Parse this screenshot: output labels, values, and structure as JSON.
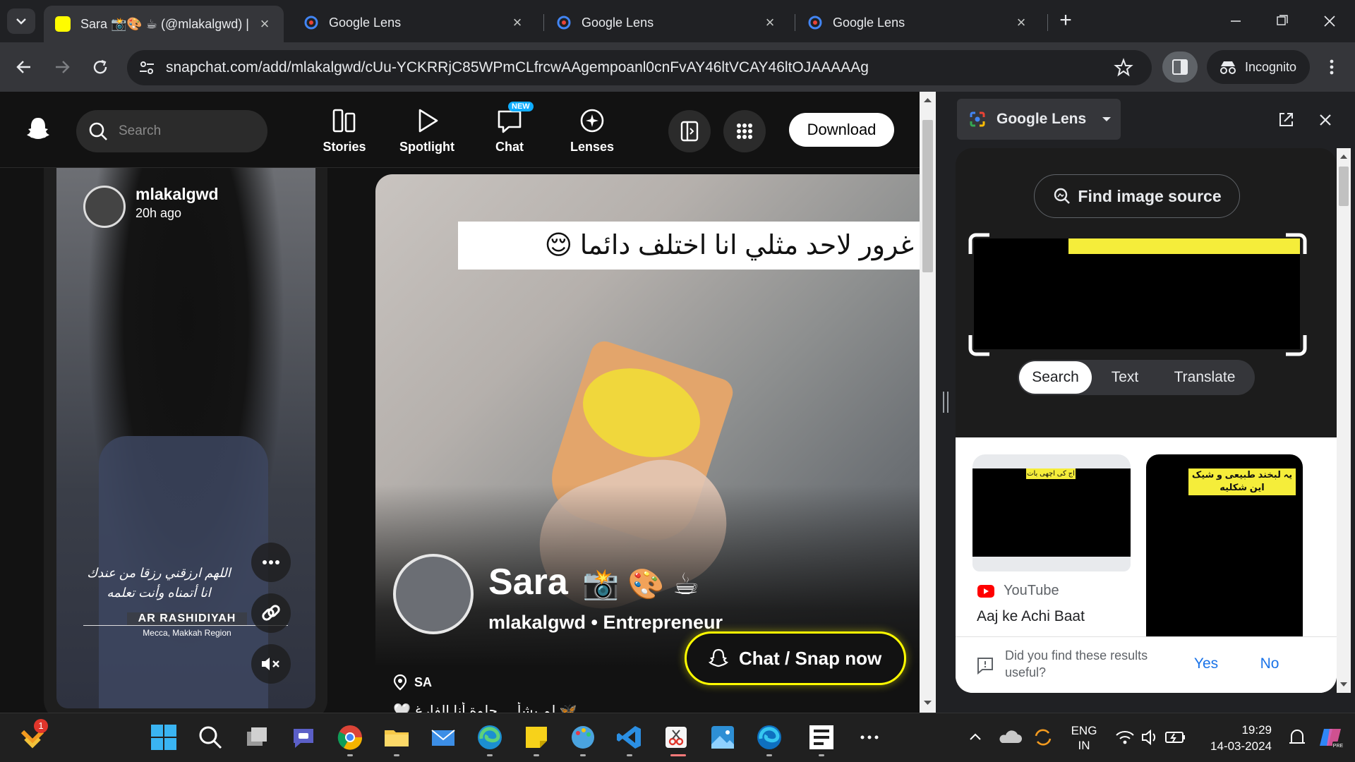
{
  "browser": {
    "tabs": [
      {
        "title": "Sara 📸🎨 ☕ (@mlakalgwd) | S",
        "active": true
      },
      {
        "title": "Google Lens",
        "active": false
      },
      {
        "title": "Google Lens",
        "active": false
      },
      {
        "title": "Google Lens",
        "active": false
      }
    ],
    "url": "snapchat.com/add/mlakalgwd/cUu-YCKRRjC85WPmCLfrcwAAgempoanl0cnFvAY46ltVCAY46ltOJAAAAAg",
    "incognito_label": "Incognito"
  },
  "snapchat": {
    "search_placeholder": "Search",
    "nav": {
      "stories": "Stories",
      "spotlight": "Spotlight",
      "chat": "Chat",
      "chat_badge": "NEW",
      "lenses": "Lenses"
    },
    "download_label": "Download",
    "story_card": {
      "username": "mlakalgwd",
      "time": "20h ago",
      "caption_line1": "اللهم ارزقني رزقا من عندك",
      "caption_line2": "انا أتمناه وأنت تعلمه",
      "location": "AR RASHIDIYAH",
      "region": "Mecca, Makkah Region"
    },
    "profile": {
      "banner_text": "غرور لاحد مثلي انا اختلف دائما 😌",
      "name": "Sara",
      "name_emoji": "📸 🎨 ☕",
      "handle": "mlakalgwd • Entrepreneur",
      "location": "SA",
      "bio_partial": "🤍 لم يشأ ... حلوة أنا الفارغ 🦋",
      "chat_button": "Chat / Snap now"
    }
  },
  "lens": {
    "title": "Google Lens",
    "find_source": "Find image source",
    "tabs": [
      "Search",
      "Text",
      "Translate"
    ],
    "results": [
      {
        "source": "YouTube",
        "title": "Aaj ke Achi Baat",
        "thumb_text": "اج کی اچھی بات"
      },
      {
        "thumb_text": "یہ لبخند طبیعی و شیک این شکلیه"
      }
    ],
    "feedback_question": "Did you find these results useful?",
    "yes": "Yes",
    "no": "No"
  },
  "taskbar": {
    "notification_count": "1",
    "language": "ENG",
    "region": "IN",
    "time": "19:29",
    "date": "14-03-2024"
  }
}
